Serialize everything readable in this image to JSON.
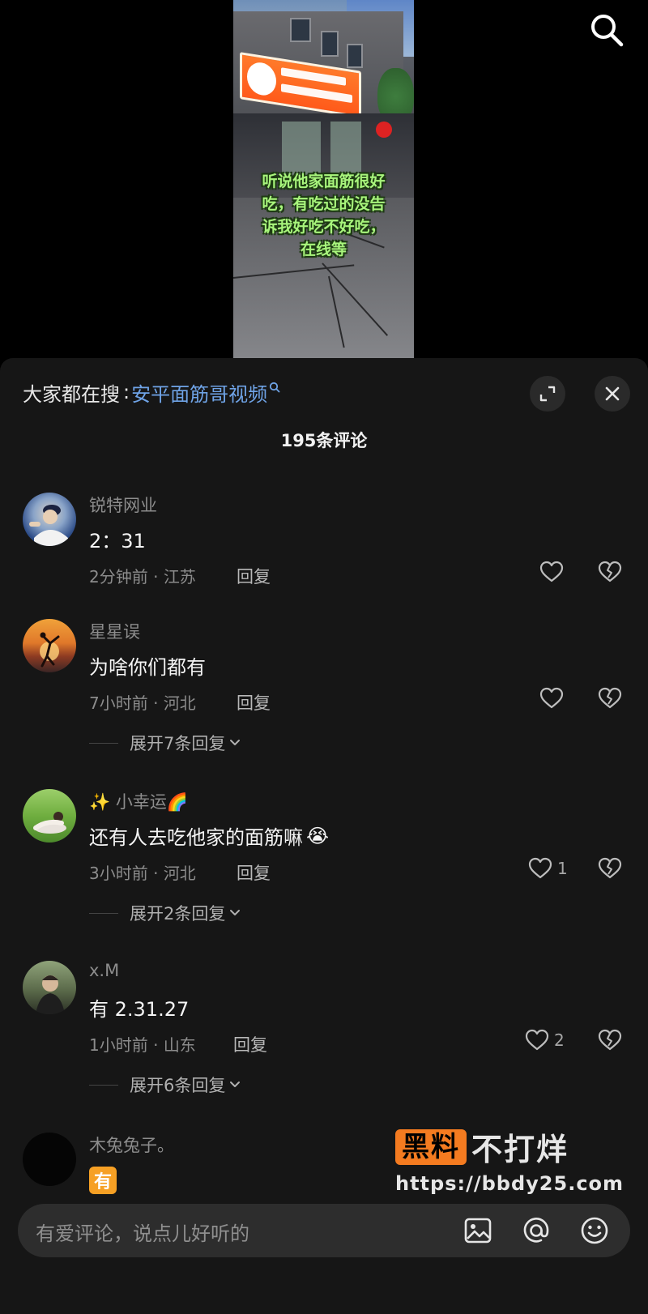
{
  "video": {
    "overlay_lines": [
      "听说他家面筋很好",
      "吃，有吃过的没告",
      "诉我好吃不好吃，",
      "在线等"
    ],
    "icons": {
      "search": "search-icon"
    }
  },
  "sheet": {
    "hot_search": {
      "prefix": "大家都在搜",
      "colon": ":",
      "term": "安平面筋哥视频"
    },
    "comment_count": "195条评论",
    "comments": [
      {
        "name": "锐特网业",
        "text": "2：31",
        "time": "2分钟前",
        "dot": " · ",
        "location": "江苏",
        "reply": "回复",
        "likes": "",
        "expand": ""
      },
      {
        "name": "星星误",
        "text": "为啥你们都有",
        "time": "7小时前",
        "dot": " · ",
        "location": "河北",
        "reply": "回复",
        "likes": "",
        "expand": "展开7条回复"
      },
      {
        "name": "✨ 小幸运🌈",
        "text": "还有人去吃他家的面筋嘛",
        "emoji": "😭",
        "time": "3小时前",
        "dot": " · ",
        "location": "河北",
        "reply": "回复",
        "likes": "1",
        "expand": "展开2条回复"
      },
      {
        "name": "x.M",
        "text": "有 2.31.27",
        "time": "1小时前",
        "dot": " · ",
        "location": "山东",
        "reply": "回复",
        "likes": "2",
        "expand": "展开6条回复"
      },
      {
        "name": "木兔兔子。",
        "badge": "有"
      }
    ]
  },
  "watermark": {
    "badge": "黑料",
    "title": "不打烊",
    "url": "https://bbdy25.com"
  },
  "input_bar": {
    "placeholder": "有爱评论，说点儿好听的"
  },
  "colors": {
    "sheet_bg": "#161616",
    "link_blue": "#6fa3e6",
    "watermark_orange": "#f47b20",
    "overlay_green": "#a8f57c"
  }
}
